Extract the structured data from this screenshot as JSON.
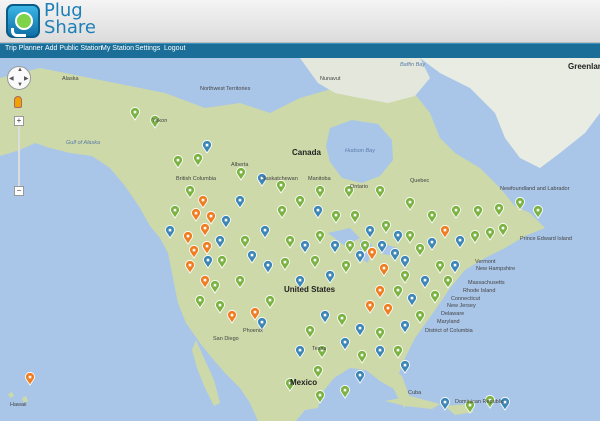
{
  "header": {
    "logo_line1": "Plug",
    "logo_line2": "Share"
  },
  "nav": {
    "items": [
      "Trip Planner",
      "Add Public Station",
      "My Station",
      "Settings",
      "Logout"
    ]
  },
  "map": {
    "labels": {
      "greenland": "Greenland",
      "canada": "Canada",
      "united_states": "United States",
      "mexico": "Mexico",
      "cuba": "Cuba",
      "dominican_republic": "Dominican Republic",
      "alaska": "Alaska",
      "northwest_territories": "Northwest Territories",
      "nunavut": "Nunavut",
      "yukon": "Yukon",
      "british_columbia": "British Columbia",
      "alberta": "Alberta",
      "saskatchewan": "Saskatchewan",
      "manitoba": "Manitoba",
      "ontario": "Ontario",
      "quebec": "Quebec",
      "newfoundland": "Newfoundland and Labrador",
      "hudson_bay": "Hudson Bay",
      "gulf_of_alaska": "Gulf of Alaska",
      "hawaii": "Hawaii",
      "san_diego": "San Diego",
      "phoenix": "Phoenix",
      "texas": "Texas",
      "vermont": "Vermont",
      "new_hampshire": "New Hampshire",
      "massachusetts": "Massachusetts",
      "rhode_island": "Rhode Island",
      "connecticut": "Connecticut",
      "new_jersey": "New Jersey",
      "delaware": "Delaware",
      "maryland": "Maryland",
      "district_of_columbia": "District of Columbia",
      "pei": "Prince Edward Island",
      "baffin_bay": "Baffin Bay"
    },
    "controls": {
      "zoom_in": "+",
      "zoom_out": "−"
    },
    "colors": {
      "green": "#7bb342",
      "blue": "#3d86b5",
      "orange": "#ef7d22"
    }
  }
}
